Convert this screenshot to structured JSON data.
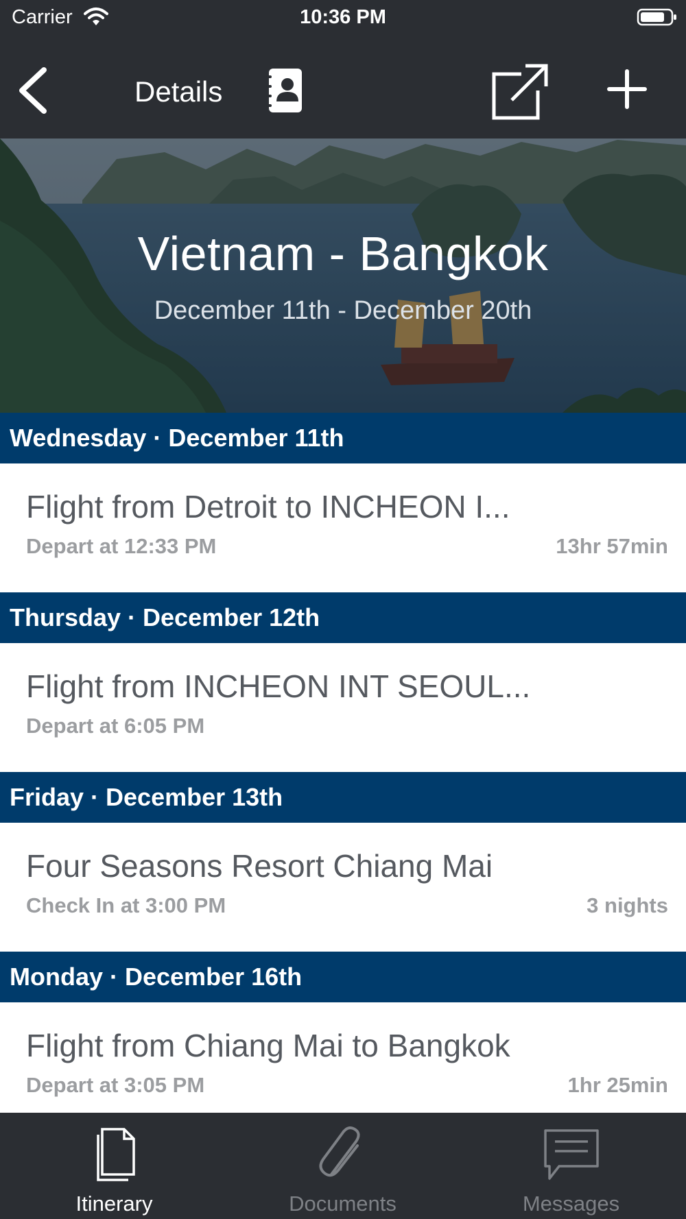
{
  "status_bar": {
    "carrier": "Carrier",
    "time": "10:36 PM"
  },
  "nav": {
    "title": "Details"
  },
  "trip": {
    "title": "Vietnam -  Bangkok",
    "dates": "December 11th - December 20th"
  },
  "days": [
    {
      "header": "Wednesday · December 11th",
      "item": {
        "name": "Flight from Detroit to INCHEON I...",
        "detail": "Depart at 12:33 PM",
        "duration": "13hr 57min"
      }
    },
    {
      "header": "Thursday · December 12th",
      "item": {
        "name": "Flight from INCHEON INT SEOUL...",
        "detail": "Depart at 6:05 PM",
        "duration": ""
      }
    },
    {
      "header": "Friday · December 13th",
      "item": {
        "name": "Four Seasons Resort Chiang Mai",
        "detail": "Check In at 3:00 PM",
        "duration": "3 nights"
      }
    },
    {
      "header": "Monday · December 16th",
      "item": {
        "name": "Flight from Chiang Mai to Bangkok",
        "detail": "Depart at 3:05 PM",
        "duration": "1hr 25min"
      }
    }
  ],
  "tabs": [
    {
      "label": "Itinerary",
      "icon": "document-icon",
      "active": true
    },
    {
      "label": "Documents",
      "icon": "paperclip-icon",
      "active": false
    },
    {
      "label": "Messages",
      "icon": "message-icon",
      "active": false
    }
  ],
  "colors": {
    "bar_background": "#2b2e33",
    "day_header": "#003b6b",
    "item_title": "#55595f",
    "item_detail": "#9b9da0"
  }
}
